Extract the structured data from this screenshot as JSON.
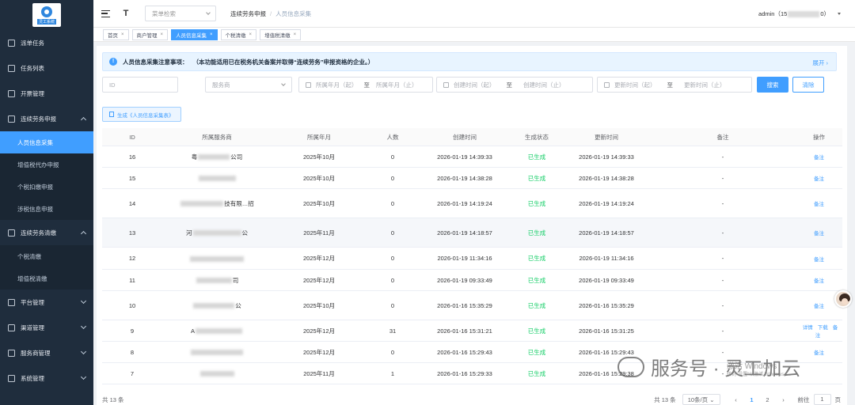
{
  "sidebar": {
    "logo_text": "灵工系统",
    "items": [
      {
        "label": "派单任务"
      },
      {
        "label": "任务列表"
      },
      {
        "label": "开票管理"
      },
      {
        "label": "连续劳务申报"
      },
      {
        "label": "人员信息采集"
      },
      {
        "label": "增值税代办申报"
      },
      {
        "label": "个税扣缴申报"
      },
      {
        "label": "涉税信息申报"
      },
      {
        "label": "连续劳务清缴"
      },
      {
        "label": "个税清缴"
      },
      {
        "label": "增值税清缴"
      },
      {
        "label": "平台管理"
      },
      {
        "label": "渠道管理"
      },
      {
        "label": "服务商管理"
      },
      {
        "label": "系统管理"
      }
    ]
  },
  "header": {
    "menu_search_placeholder": "菜单检索",
    "breadcrumb": [
      "连续劳务申报",
      "人员信息采集"
    ],
    "user_prefix": "admin（15",
    "user_suffix": "0）"
  },
  "tags": [
    "首页",
    "商户管理",
    "人员信息采集",
    "个税清缴",
    "增值税清缴"
  ],
  "notice": {
    "lead": "人员信息采集注意事项：",
    "text": "（本功能适用已在税务机关备案并取得“连续劳务”申报资格的企业。）",
    "expand": "展开"
  },
  "filters": {
    "id_placeholder": "ID",
    "provider_placeholder": "服务商",
    "month_start": "所属年月（起）",
    "month_end": "所属年月（止）",
    "create_start": "创建时间（起）",
    "create_end": "创建时间（止）",
    "update_start": "更新时间（起）",
    "update_end": "更新时间（止）",
    "range_sep": "至",
    "search_label": "搜索",
    "clear_label": "清除"
  },
  "generate_label": "生成《人员信息采集表》",
  "table": {
    "headers": [
      "ID",
      "所属服务商",
      "所属年月",
      "人数",
      "创建时间",
      "生成状态",
      "更新时间",
      "备注",
      "操作"
    ],
    "rows": [
      {
        "id": "16",
        "prov_a": "粤",
        "prov_b": "公司",
        "month": "2025年10月",
        "count": "0",
        "ctime": "2026-01-19 14:39:33",
        "status": "已生成",
        "utime": "2026-01-19 14:39:33",
        "note": "-",
        "ops": [
          "备注"
        ]
      },
      {
        "id": "15",
        "prov_a": "",
        "prov_b": "",
        "month": "2025年10月",
        "count": "0",
        "ctime": "2026-01-19 14:38:28",
        "status": "已生成",
        "utime": "2026-01-19 14:38:28",
        "note": "-",
        "ops": [
          "备注"
        ]
      },
      {
        "id": "14",
        "prov_a": "",
        "prov_b": "技有限…招",
        "month": "2025年10月",
        "count": "0",
        "ctime": "2026-01-19 14:19:24",
        "status": "已生成",
        "utime": "2026-01-19 14:19:24",
        "note": "-",
        "ops": [
          "备注"
        ]
      },
      {
        "id": "13",
        "prov_a": "河",
        "prov_b": "公",
        "month": "2025年11月",
        "count": "0",
        "ctime": "2026-01-19 14:18:57",
        "status": "已生成",
        "utime": "2026-01-19 14:18:57",
        "note": "-",
        "ops": [
          "备注"
        ]
      },
      {
        "id": "12",
        "prov_a": "",
        "prov_b": "",
        "month": "2025年12月",
        "count": "0",
        "ctime": "2026-01-19 11:34:16",
        "status": "已生成",
        "utime": "2026-01-19 11:34:16",
        "note": "-",
        "ops": [
          "备注"
        ]
      },
      {
        "id": "11",
        "prov_a": "",
        "prov_b": "司",
        "month": "2025年12月",
        "count": "0",
        "ctime": "2026-01-19 09:33:49",
        "status": "已生成",
        "utime": "2026-01-19 09:33:49",
        "note": "-",
        "ops": [
          "备注"
        ]
      },
      {
        "id": "10",
        "prov_a": "",
        "prov_b": "公",
        "month": "2025年10月",
        "count": "0",
        "ctime": "2026-01-16 15:35:29",
        "status": "已生成",
        "utime": "2026-01-16 15:35:29",
        "note": "-",
        "ops": [
          "备注"
        ]
      },
      {
        "id": "9",
        "prov_a": "A",
        "prov_b": "",
        "month": "2025年12月",
        "count": "31",
        "ctime": "2026-01-16 15:31:21",
        "status": "已生成",
        "utime": "2026-01-16 15:31:25",
        "note": "-",
        "ops": [
          "详情",
          "下载",
          "备注"
        ]
      },
      {
        "id": "8",
        "prov_a": "",
        "prov_b": "",
        "month": "2025年12月",
        "count": "0",
        "ctime": "2026-01-16 15:29:43",
        "status": "已生成",
        "utime": "2026-01-16 15:29:43",
        "note": "-",
        "ops": [
          "备注"
        ]
      },
      {
        "id": "7",
        "prov_a": "",
        "prov_b": "",
        "month": "2025年11月",
        "count": "1",
        "ctime": "2026-01-16 15:29:33",
        "status": "已生成",
        "utime": "2026-01-16 15:29:38",
        "note": "-",
        "ops": []
      }
    ]
  },
  "footer": {
    "total_left": "共 13 条",
    "total_right": "共 13 条",
    "page_size": "10条/页",
    "pages": [
      "1",
      "2"
    ],
    "goto_prefix": "前往",
    "goto_value": "1",
    "goto_suffix": "页"
  },
  "watermark": {
    "text": "服务号 · 灵工加云",
    "activate_main": "激活 Windows",
    "activate_sub": "转到\"设置\"以激活 Windows。"
  },
  "colors": {
    "sidebar_bg": "#1f2d3d",
    "primary": "#409eff",
    "success": "#13ce66"
  }
}
